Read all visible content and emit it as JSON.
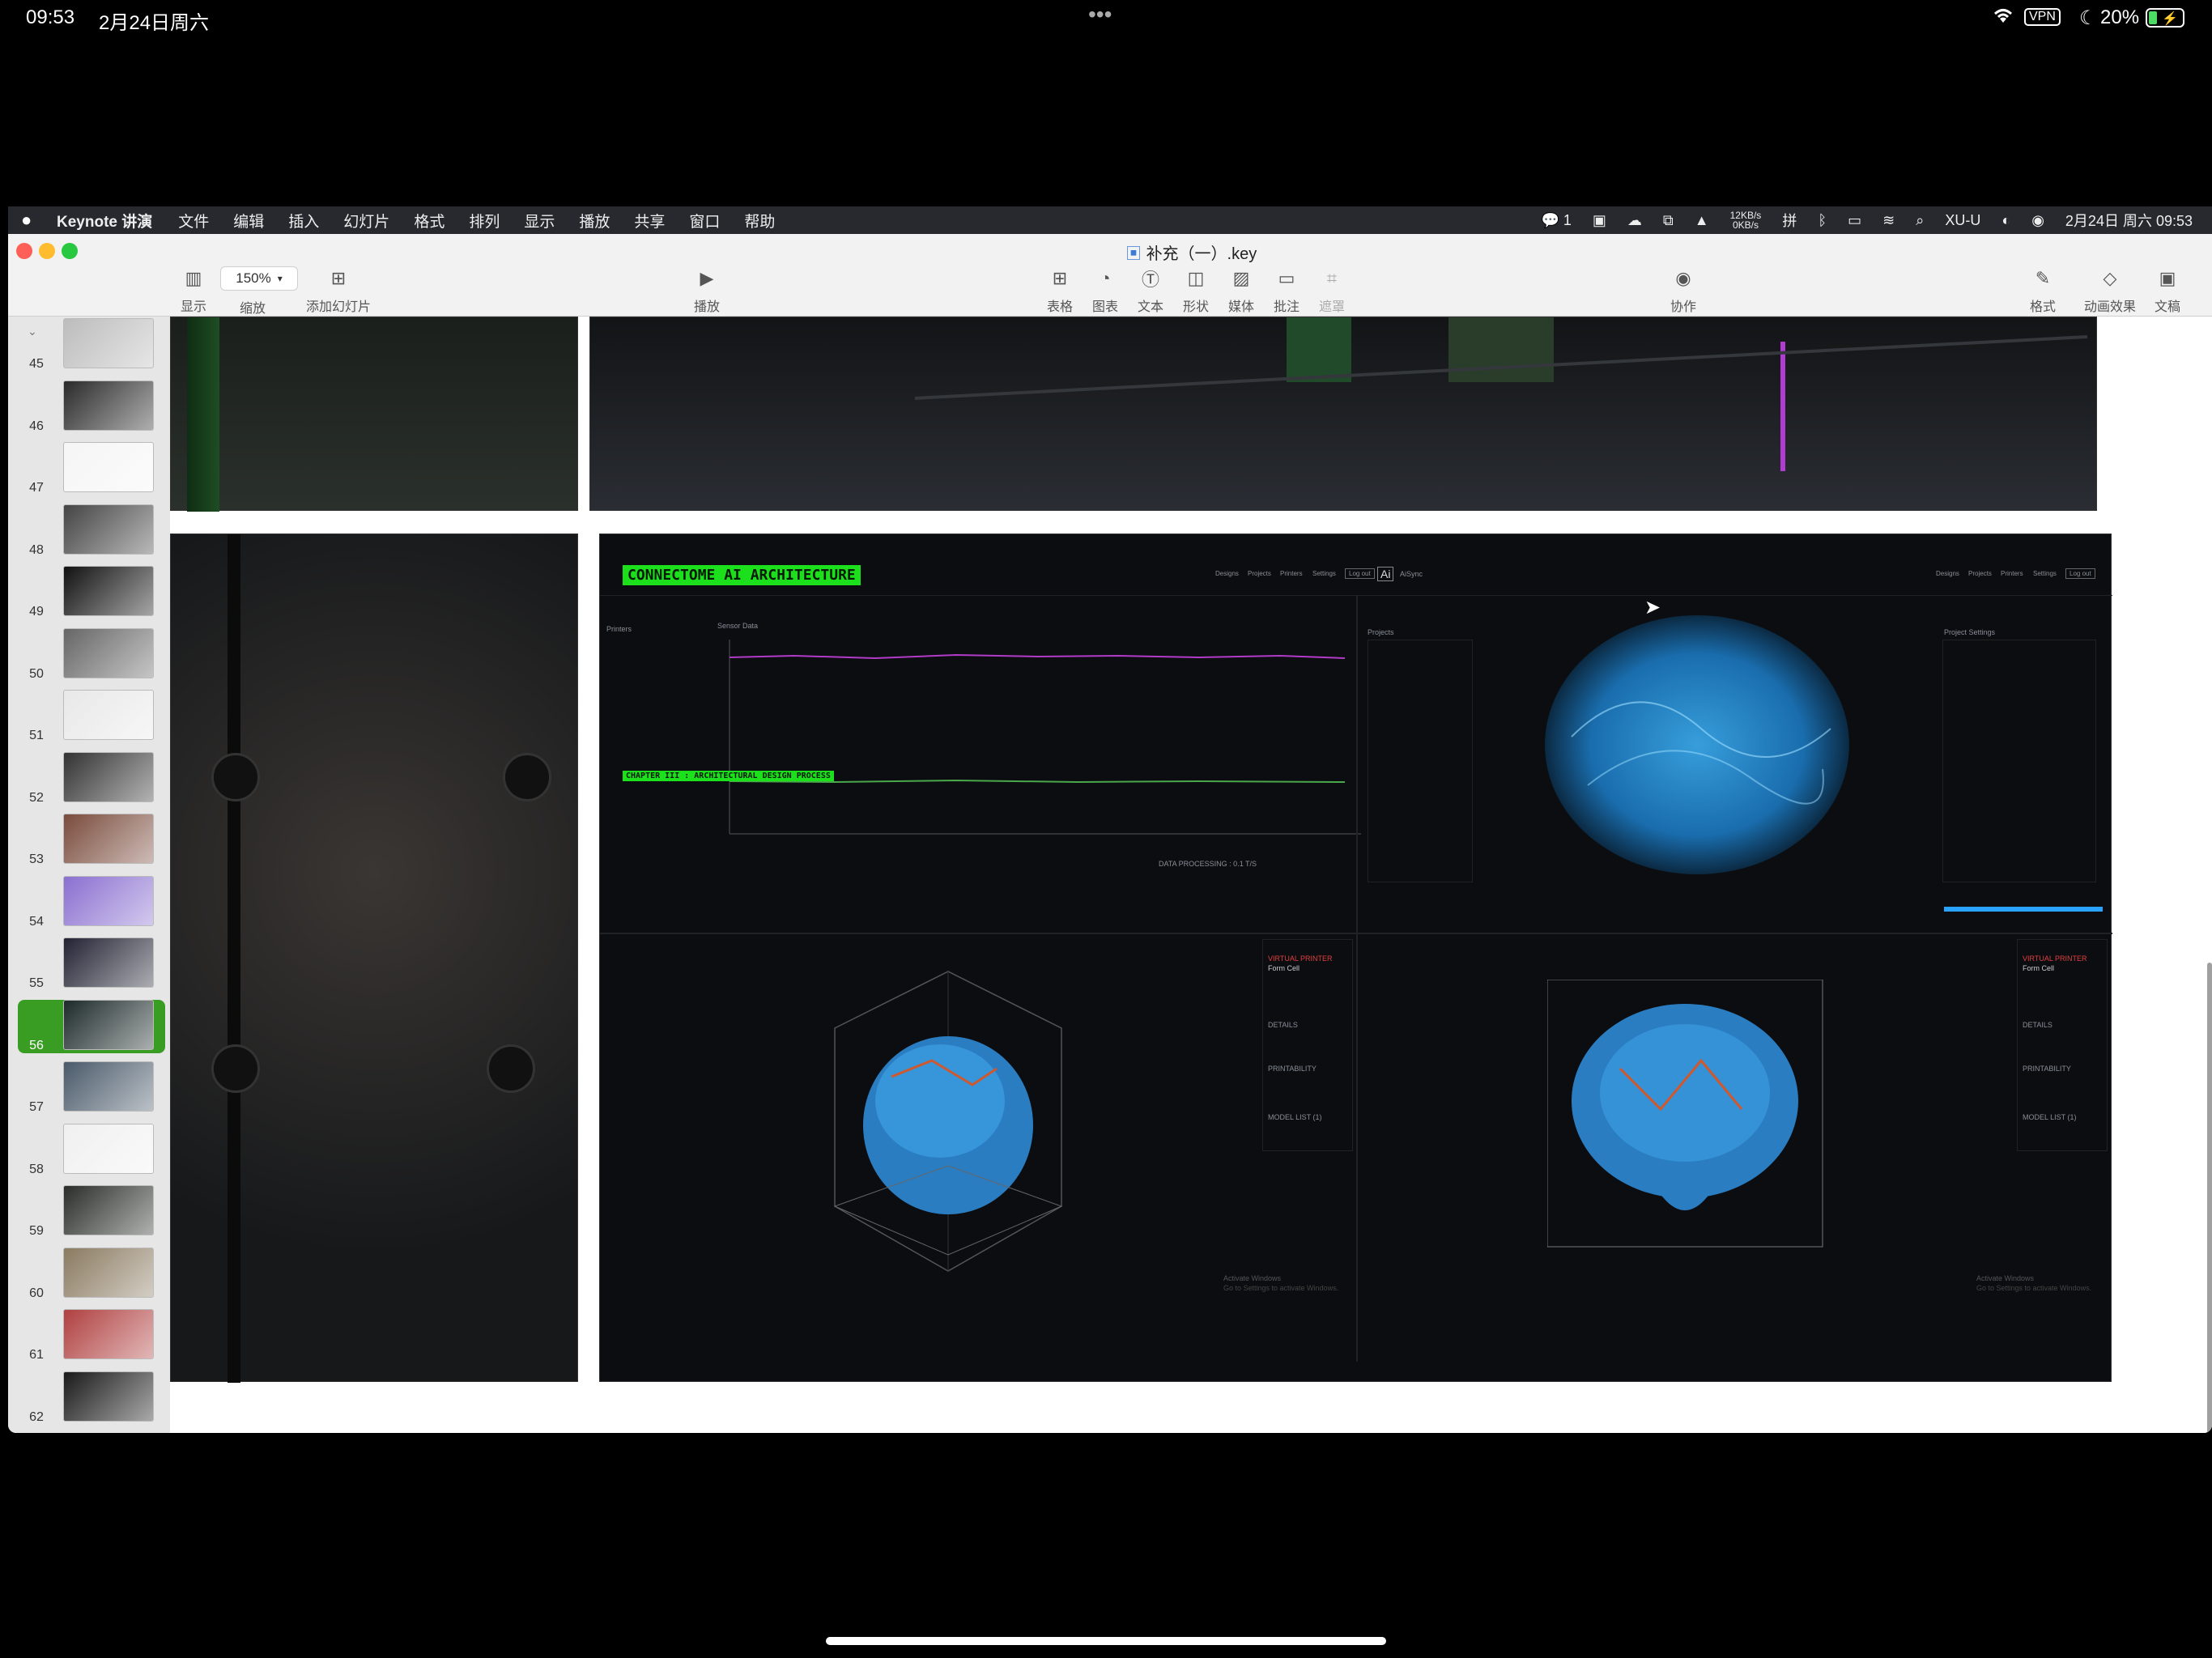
{
  "ipad": {
    "time": "09:53",
    "date": "2月24日周六",
    "dots": "•••",
    "vpn": "VPN",
    "battery": "20%"
  },
  "menubar": {
    "app": "Keynote 讲演",
    "items": [
      "文件",
      "编辑",
      "插入",
      "幻灯片",
      "格式",
      "排列",
      "显示",
      "播放",
      "共享",
      "窗口",
      "帮助"
    ],
    "wechat_count": "1",
    "net_speed_up": "12KB/s",
    "net_speed_down": "0KB/s",
    "user": "XU-U",
    "datetime": "2月24日 周六 09:53"
  },
  "window": {
    "title": "补充（一）.key",
    "zoom": "150%",
    "toolbar_left": [
      {
        "label": "显示",
        "icon": "sidebar-icon"
      },
      {
        "label": "缩放",
        "icon": "zoom-icon"
      },
      {
        "label": "添加幻灯片",
        "icon": "add-slide-icon"
      }
    ],
    "play_label": "播放",
    "toolbar_center": [
      {
        "label": "表格",
        "icon": "table-icon"
      },
      {
        "label": "图表",
        "icon": "chart-icon"
      },
      {
        "label": "文本",
        "icon": "text-icon"
      },
      {
        "label": "形状",
        "icon": "shape-icon"
      },
      {
        "label": "媒体",
        "icon": "media-icon"
      },
      {
        "label": "批注",
        "icon": "comment-icon"
      },
      {
        "label": "遮罩",
        "icon": "mask-icon"
      }
    ],
    "collab_label": "协作",
    "toolbar_right": [
      {
        "label": "格式",
        "icon": "format-icon"
      },
      {
        "label": "动画效果",
        "icon": "animate-icon"
      },
      {
        "label": "文稿",
        "icon": "document-icon"
      }
    ]
  },
  "slides": {
    "numbers": [
      "45",
      "46",
      "47",
      "48",
      "49",
      "50",
      "51",
      "52",
      "53",
      "54",
      "55",
      "56",
      "57",
      "58",
      "59",
      "60",
      "61",
      "62"
    ],
    "selected": "56"
  },
  "slide": {
    "left_title": "CONNECTOME AI ARCHITECTURE",
    "chapter": "CHAPTER III : ARCHITECTURAL DESIGN PROCESS",
    "sensor_label": "Sensor Data",
    "printers_label": "Printers",
    "projects_label": "Projects",
    "project_settings": "Project Settings",
    "app_name": "AiSync",
    "nav": [
      "Designs",
      "Projects",
      "Printers",
      "Settings",
      "Log out"
    ],
    "form_cell": "Form Cell",
    "virtual_printer": "VIRTUAL PRINTER",
    "details": "DETAILS",
    "printability": "PRINTABILITY",
    "model_list": "MODEL LIST (1)",
    "activate": "Activate Windows",
    "activate_sub": "Go to Settings to activate Windows.",
    "processing": "DATA PROCESSING : 0.1 T/S"
  }
}
